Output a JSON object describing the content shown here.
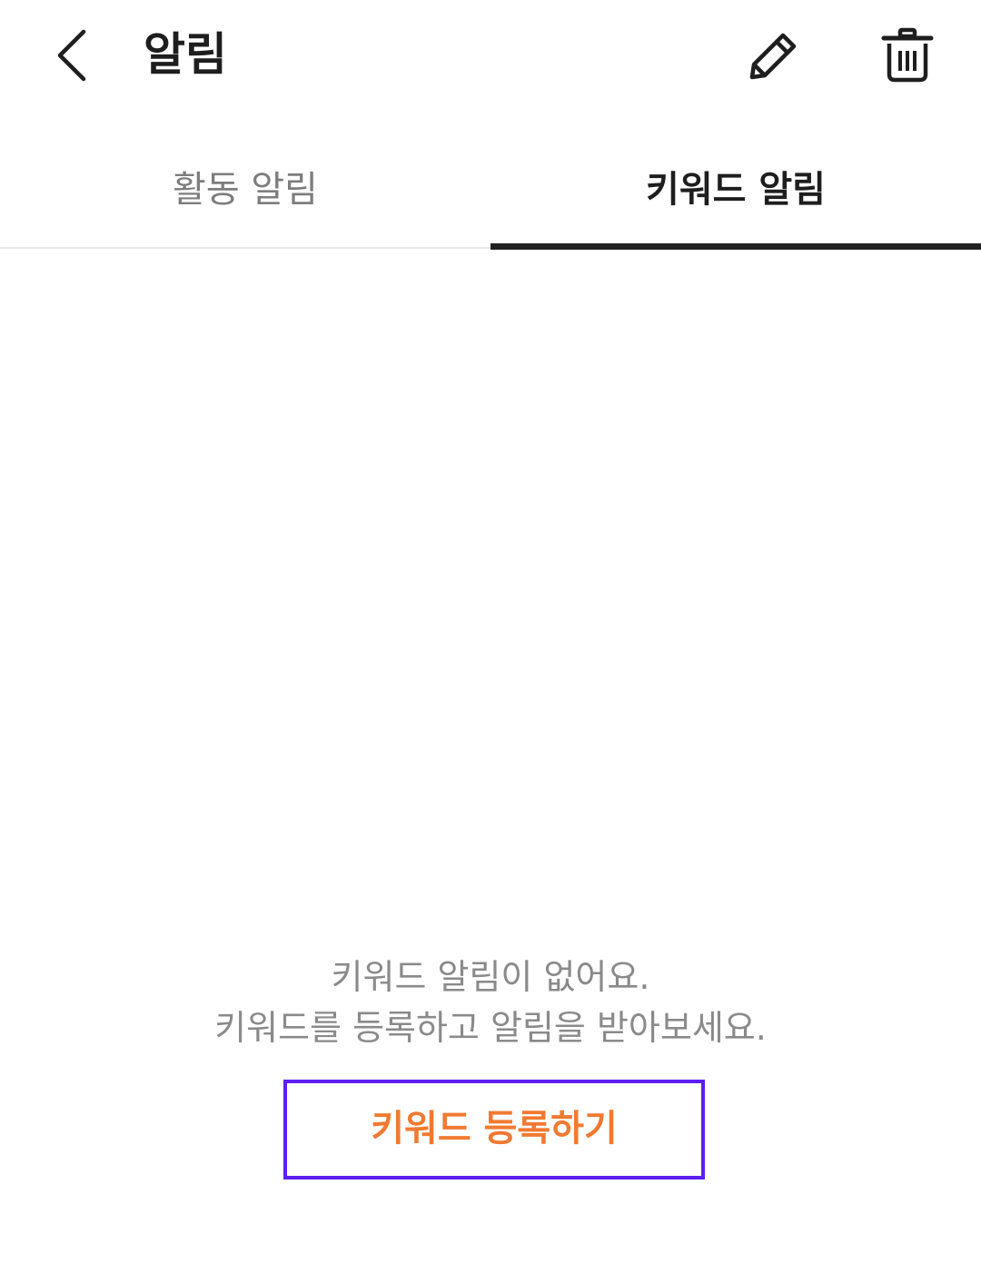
{
  "header": {
    "title": "알림",
    "back_icon": "chevron-left-icon",
    "edit_icon": "pencil-icon",
    "delete_icon": "trash-icon"
  },
  "tabs": [
    {
      "label": "활동 알림",
      "active": false
    },
    {
      "label": "키워드 알림",
      "active": true
    }
  ],
  "empty_state": {
    "line1": "키워드 알림이 없어요.",
    "line2": "키워드를 등록하고 알림을 받아보세요."
  },
  "register_button": {
    "label": "키워드 등록하기"
  },
  "colors": {
    "accent_orange": "#f07a32",
    "button_border": "#5b1ff0",
    "tab_indicator": "#222222",
    "inactive_text": "#7d7d7d",
    "muted_text": "#8a8a8a"
  }
}
